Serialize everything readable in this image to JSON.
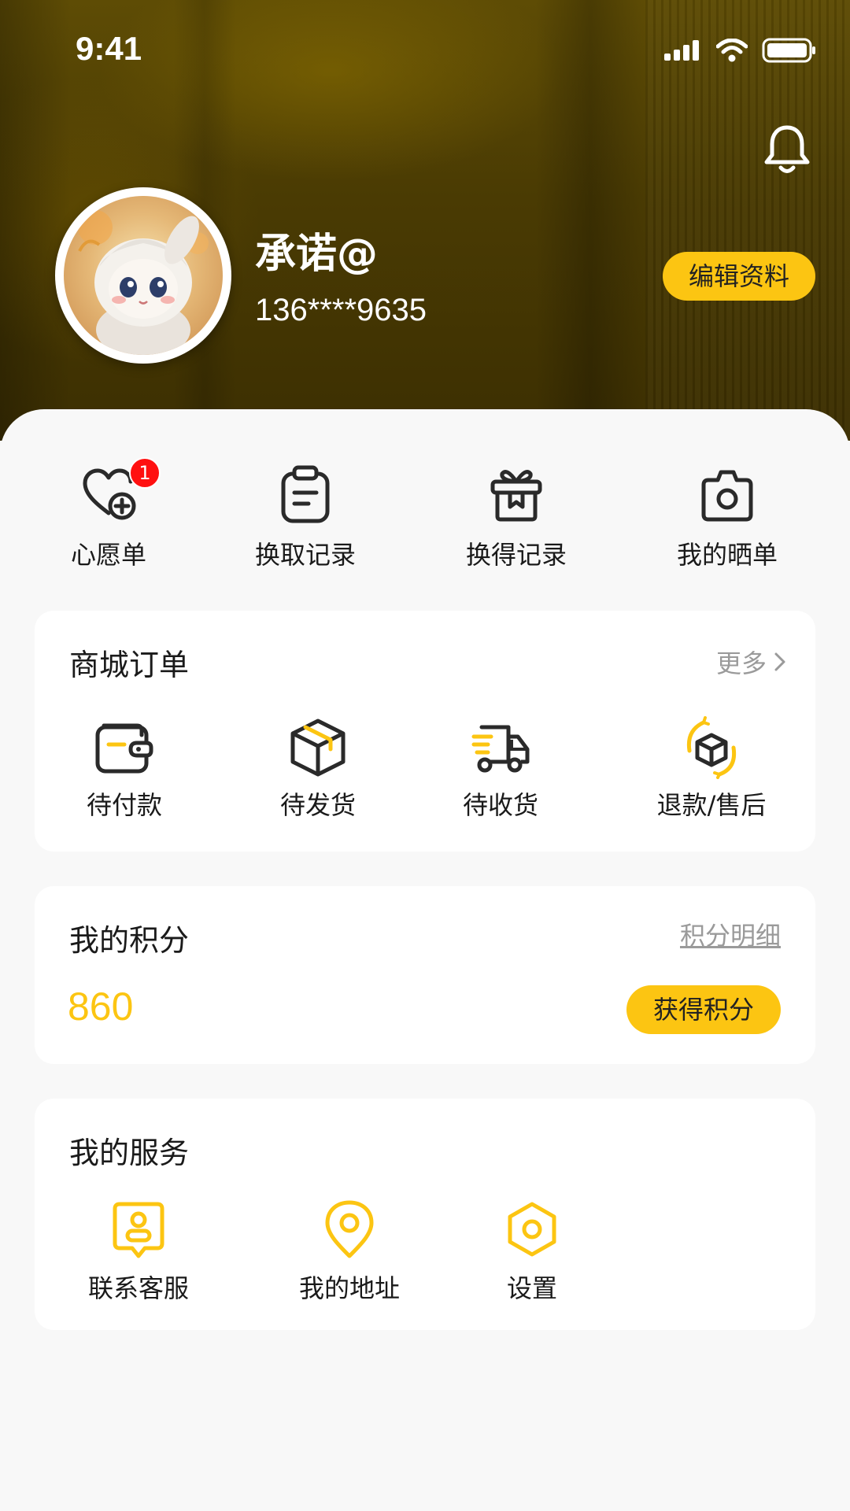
{
  "status_bar": {
    "time": "9:41"
  },
  "profile": {
    "username": "承诺@",
    "phone": "136****9635",
    "edit_label": "编辑资料"
  },
  "quick_actions": [
    {
      "label": "心愿单",
      "icon": "heart-plus-icon",
      "badge": "1"
    },
    {
      "label": "换取记录",
      "icon": "clipboard-icon"
    },
    {
      "label": "换得记录",
      "icon": "gift-box-icon"
    },
    {
      "label": "我的晒单",
      "icon": "camera-icon"
    }
  ],
  "orders": {
    "title": "商城订单",
    "more_label": "更多",
    "items": [
      {
        "label": "待付款",
        "icon": "wallet-icon"
      },
      {
        "label": "待发货",
        "icon": "package-icon"
      },
      {
        "label": "待收货",
        "icon": "delivery-truck-icon"
      },
      {
        "label": "退款/售后",
        "icon": "refund-cycle-icon"
      }
    ]
  },
  "points": {
    "title": "我的积分",
    "detail_label": "积分明细",
    "value": "860",
    "earn_label": "获得积分"
  },
  "services": {
    "title": "我的服务",
    "items": [
      {
        "label": "联系客服",
        "icon": "customer-service-icon"
      },
      {
        "label": "我的地址",
        "icon": "location-pin-icon"
      },
      {
        "label": "设置",
        "icon": "settings-hexagon-icon"
      }
    ]
  },
  "colors": {
    "accent": "#fcc512",
    "header_bg": "#4a3b03",
    "badge": "#ff1010"
  }
}
